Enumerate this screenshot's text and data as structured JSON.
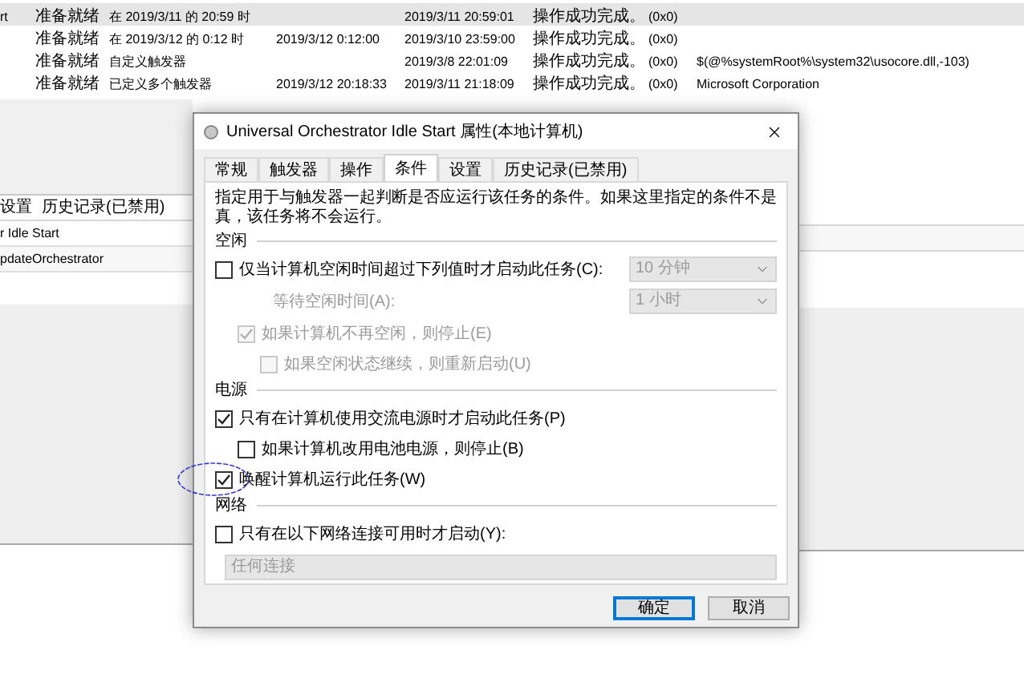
{
  "task_table": {
    "rows": [
      {
        "name": "rt",
        "status": "准备就绪",
        "trigger": "在 2019/3/11 的 20:59 时",
        "last_run": "2019/3/11 20:59:01",
        "last_result": "操作成功完成。",
        "result_code": "(0x0)",
        "selected": true
      },
      {
        "status": "准备就绪",
        "trigger": "在 2019/3/12 的 0:12 时",
        "next_run": "2019/3/12 0:12:00",
        "last_run": "2019/3/10 23:59:00",
        "last_result": "操作成功完成。",
        "result_code": "(0x0)",
        "selected": false
      },
      {
        "status": "准备就绪",
        "trigger": "自定义触发器",
        "last_run": "2019/3/8 22:01:09",
        "last_result": "操作成功完成。",
        "result_code": "(0x0)",
        "author": "$(@%systemRoot%\\system32\\usocore.dll,-103)",
        "selected": false
      },
      {
        "status": "准备就绪",
        "trigger": "已定义多个触发器",
        "next_run": "2019/3/12 20:18:33",
        "last_run": "2019/3/11 21:18:09",
        "last_result": "操作成功完成。",
        "result_code": "(0x0)",
        "author": "Microsoft Corporation",
        "selected": false
      }
    ]
  },
  "detail_pane": {
    "tabs": [
      "设置",
      "历史记录(已禁用)"
    ],
    "lines": [
      "r Idle Start",
      "pdateOrchestrator"
    ]
  },
  "dialog": {
    "title": "Universal Orchestrator Idle Start 属性(本地计算机)",
    "tabs": [
      {
        "label": "常规",
        "selected": false
      },
      {
        "label": "触发器",
        "selected": false
      },
      {
        "label": "操作",
        "selected": false
      },
      {
        "label": "条件",
        "selected": true
      },
      {
        "label": "设置",
        "selected": false
      },
      {
        "label": "历史记录(已禁用)",
        "selected": false
      }
    ],
    "description": "指定用于与触发器一起判断是否应运行该任务的条件。如果这里指定的条件不是真，该任务将不会运行。",
    "sections": [
      {
        "title": "空闲",
        "items": [
          {
            "kind": "checkbox",
            "label": "仅当计算机空闲时间超过下列值时才启动此任务(C):",
            "checked": false,
            "disabled": false,
            "dropdown": {
              "value": "10 分钟",
              "disabled": true
            },
            "children": [
              {
                "kind": "label",
                "label": "等待空闲时间(A):",
                "disabled": true,
                "dropdown": {
                  "value": "1 小时",
                  "disabled": true
                }
              },
              {
                "kind": "checkbox",
                "label": "如果计算机不再空闲，则停止(E)",
                "checked": true,
                "disabled": true,
                "children": [
                  {
                    "kind": "checkbox",
                    "label": "如果空闲状态继续，则重新启动(U)",
                    "checked": false,
                    "disabled": true
                  }
                ]
              }
            ]
          }
        ]
      },
      {
        "title": "电源",
        "items": [
          {
            "kind": "checkbox",
            "label": "只有在计算机使用交流电源时才启动此任务(P)",
            "checked": true,
            "disabled": false,
            "children": [
              {
                "kind": "checkbox",
                "label": "如果计算机改用电池电源，则停止(B)",
                "checked": false,
                "disabled": false
              }
            ]
          },
          {
            "kind": "checkbox",
            "label": "唤醒计算机运行此任务(W)",
            "checked": true,
            "disabled": false,
            "circled": true
          }
        ]
      },
      {
        "title": "网络",
        "items": [
          {
            "kind": "checkbox",
            "label": "只有在以下网络连接可用时才启动(Y):",
            "checked": false,
            "disabled": false
          },
          {
            "kind": "wide_dropdown",
            "value": "任何连接",
            "disabled": true
          }
        ]
      }
    ],
    "buttons": [
      {
        "label": "确定",
        "default": true
      },
      {
        "label": "取消",
        "default": false
      }
    ]
  }
}
